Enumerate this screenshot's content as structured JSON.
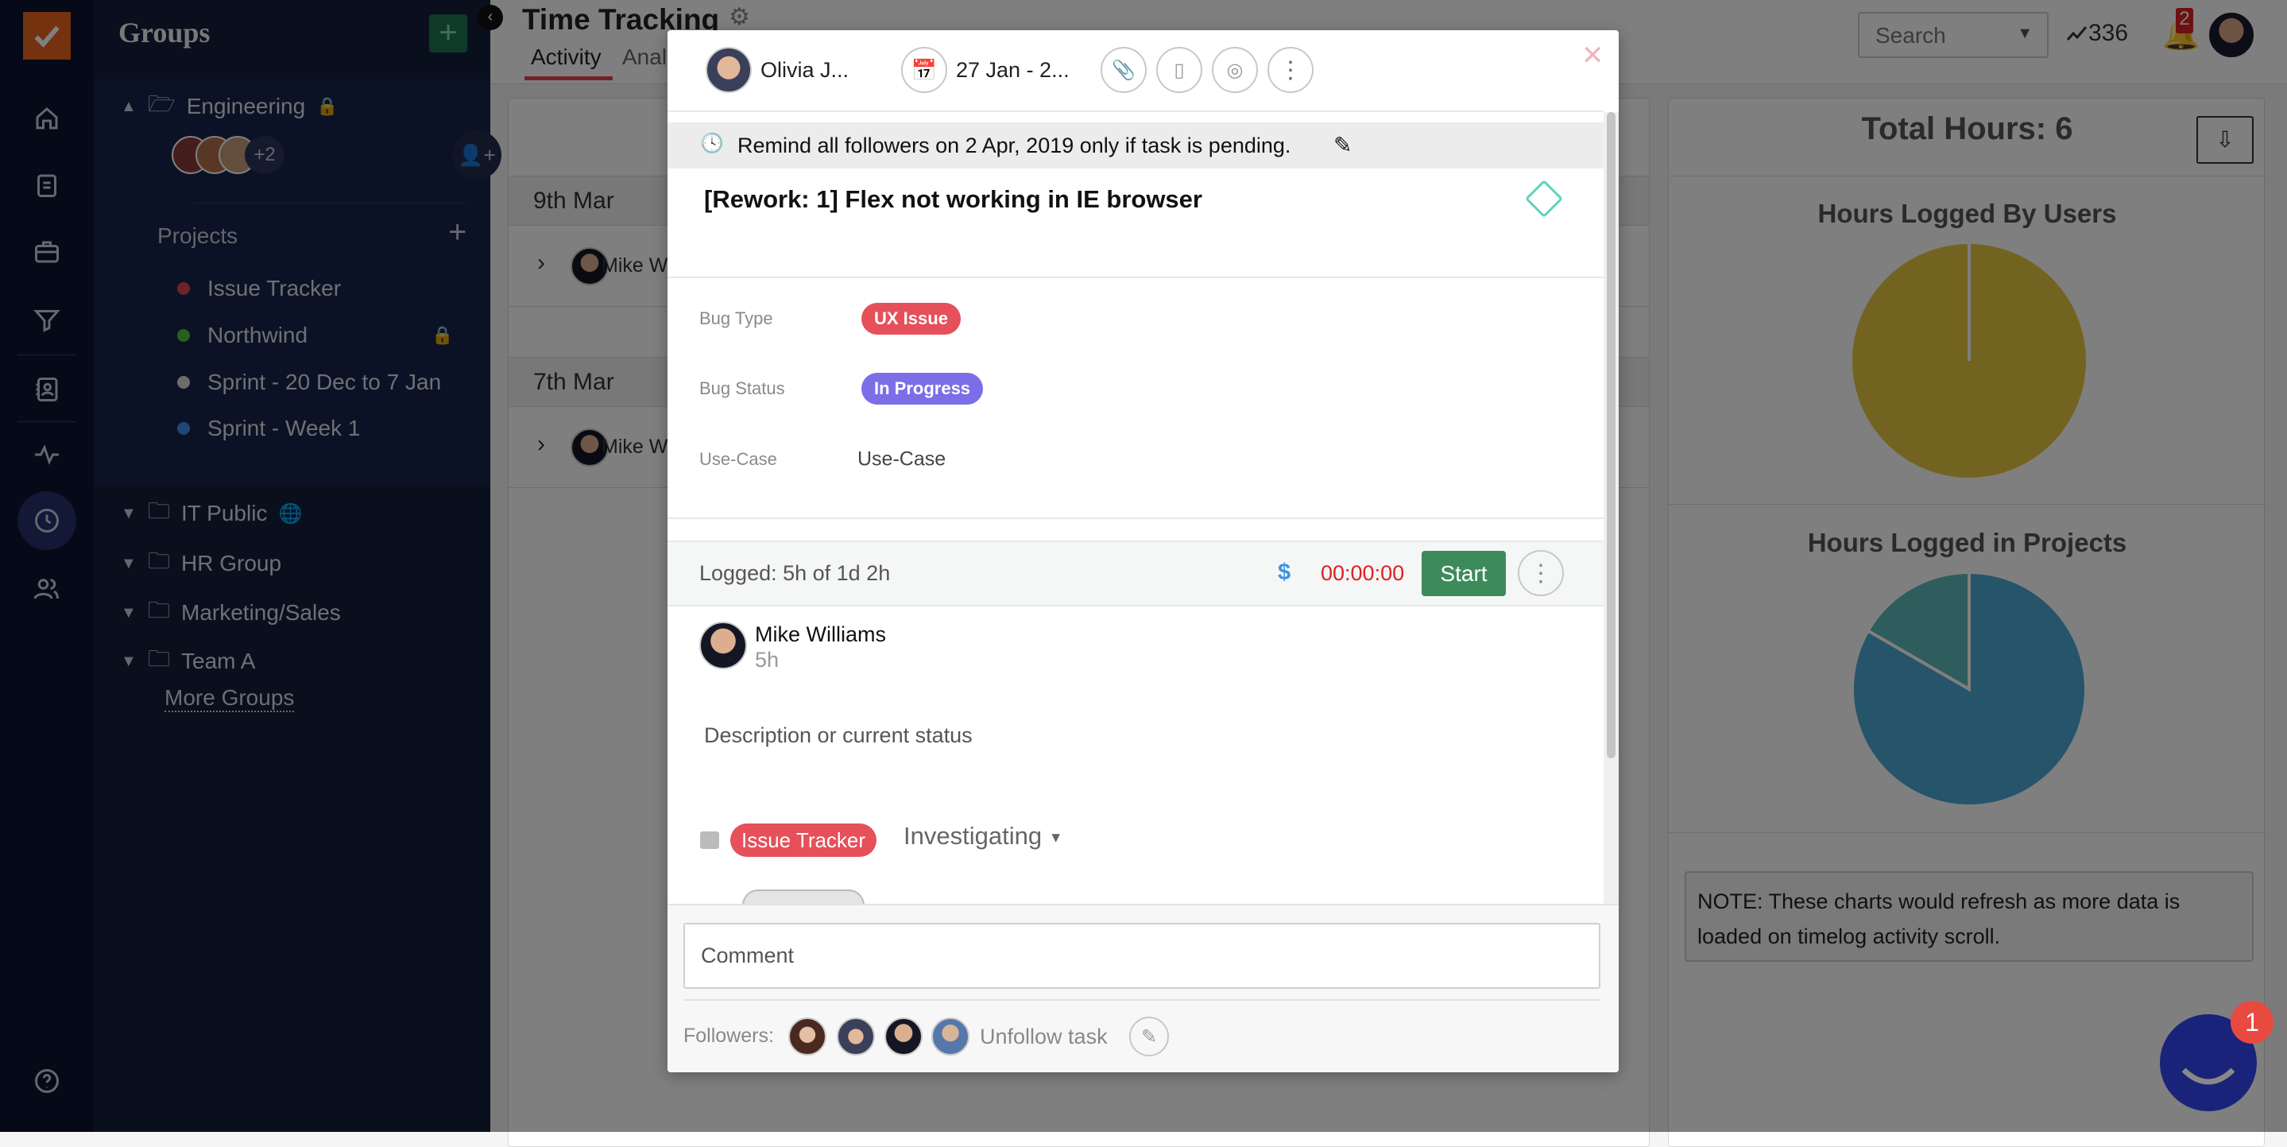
{
  "rail": {
    "items": [
      "home-icon",
      "clipboard-icon",
      "briefcase-icon",
      "filter-icon",
      "contacts-icon",
      "activity-icon",
      "clock-icon",
      "users-icon",
      "help-icon"
    ],
    "active": "clock-icon"
  },
  "groups": {
    "title": "Groups",
    "expanded": {
      "name": "Engineering",
      "extra_members": "+2",
      "projects_label": "Projects",
      "projects": [
        {
          "name": "Issue Tracker",
          "color": "#e0474f"
        },
        {
          "name": "Northwind",
          "color": "#4cc23a",
          "locked": true
        },
        {
          "name": "Sprint - 20 Dec to 7 Jan",
          "color": "#d9d9d9"
        },
        {
          "name": "Sprint - Week 1",
          "color": "#3d8ef0"
        }
      ]
    },
    "collapsed": [
      {
        "name": "IT Public"
      },
      {
        "name": "HR Group"
      },
      {
        "name": "Marketing/Sales"
      },
      {
        "name": "Team A"
      }
    ],
    "more": "More Groups"
  },
  "header": {
    "title": "Time Tracking",
    "tabs": [
      "Activity",
      "Anal"
    ],
    "search_placeholder": "Search",
    "trend_count": "336",
    "notification_count": "2",
    "accent": "#e0474f"
  },
  "activity": {
    "days": [
      {
        "date": "9th Mar",
        "user": "Mike W"
      },
      {
        "date": "7th Mar",
        "user": "Mike W"
      }
    ]
  },
  "stats": {
    "total": "Total Hours: 6",
    "chart1_title": "Hours Logged By Users",
    "chart2_title": "Hours Logged in Projects",
    "note": "NOTE: These charts would refresh as more data is loaded on timelog activity scroll."
  },
  "chart_data": [
    {
      "type": "pie",
      "title": "Hours Logged By Users",
      "values": [
        6
      ],
      "colors": [
        "#e6c640"
      ]
    },
    {
      "type": "pie",
      "title": "Hours Logged in Projects",
      "values": [
        5,
        1
      ],
      "colors": [
        "#4aa8d6",
        "#5eb8b8"
      ]
    }
  ],
  "modal": {
    "assignee": "Olivia J...",
    "dates": "27 Jan - 2...",
    "reminder": "Remind all followers on 2 Apr, 2019 only if task is pending.",
    "title": "[Rework: 1] Flex not working in IE browser",
    "fields": [
      {
        "label": "Bug Type",
        "value": "UX Issue",
        "color": "#e5505a"
      },
      {
        "label": "Bug Status",
        "value": "In Progress",
        "color": "#7b6ee6"
      },
      {
        "label": "Use-Case",
        "value": "Use-Case"
      }
    ],
    "logged": "Logged: 5h of 1d 2h",
    "billing_symbol": "$",
    "timer": "00:00:00",
    "start_label": "Start",
    "log_entry": {
      "user": "Mike Williams",
      "hours": "5h"
    },
    "description_placeholder": "Description or current status",
    "project": "Issue Tracker",
    "status": "Investigating",
    "comment_placeholder": "Comment",
    "followers_label": "Followers:",
    "unfollow_label": "Unfollow task"
  },
  "chat": {
    "badge": "1",
    "color": "#3346e6"
  }
}
